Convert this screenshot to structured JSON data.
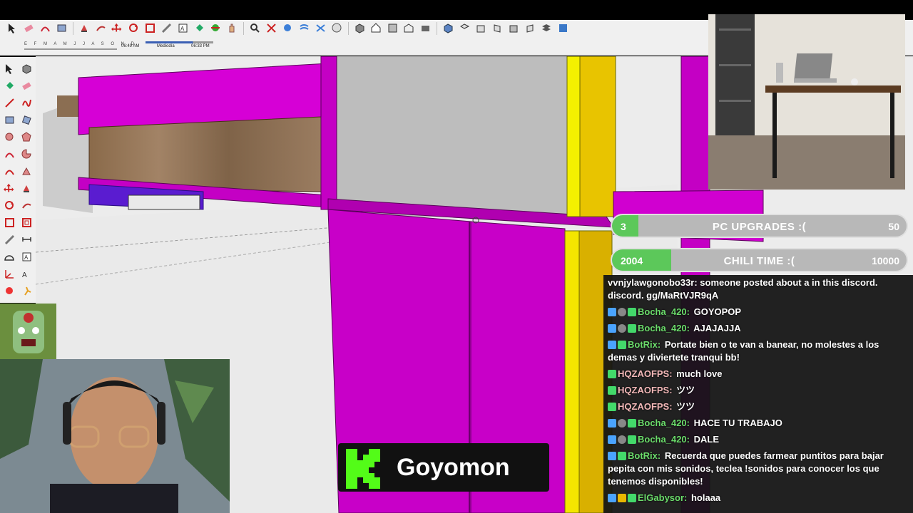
{
  "shadow": {
    "months": "E F M A M J J A S O N D",
    "time_start": "06:49 AM",
    "time_mid": "Mediodía",
    "time_end": "06:33 PM"
  },
  "goals": [
    {
      "count": "3",
      "label": "PC UPGRADES :(",
      "target": "50",
      "progress": 0.06,
      "color": "#5cc85a"
    },
    {
      "count": "2004",
      "label": "CHILI TIME :(",
      "target": "10000",
      "progress": 0.2,
      "color": "#5cc85a"
    }
  ],
  "chat": {
    "messages": [
      {
        "user": "",
        "user_color": "#ffffff",
        "text": "vvnjylawgonobo33r: someone posted about a in this discord. discord. gg/MaRtVJR9qA",
        "badges": []
      },
      {
        "user": "Bocha_420",
        "user_color": "#6bdc6b",
        "text": "GOYOPOP",
        "badges": [
          "blue",
          "gray",
          "green"
        ]
      },
      {
        "user": "Bocha_420",
        "user_color": "#6bdc6b",
        "text": "AJAJAJJA",
        "badges": [
          "blue",
          "gray",
          "green"
        ]
      },
      {
        "user": "BotRix",
        "user_color": "#6bdc6b",
        "text": "Portate bien o te van a banear, no molestes a los demas y diviertete tranqui bb!",
        "badges": [
          "blue",
          "green"
        ]
      },
      {
        "user": "HQZAOFPS",
        "user_color": "#f1b7b7",
        "text": "much love",
        "badges": [
          "green"
        ]
      },
      {
        "user": "HQZAOFPS",
        "user_color": "#f1b7b7",
        "text": "ツツ",
        "badges": [
          "green"
        ]
      },
      {
        "user": "HQZAOFPS",
        "user_color": "#f1b7b7",
        "text": "ツツ",
        "badges": [
          "green"
        ]
      },
      {
        "user": "Bocha_420",
        "user_color": "#6bdc6b",
        "text": "HACE TU TRABAJO",
        "badges": [
          "blue",
          "gray",
          "green"
        ]
      },
      {
        "user": "Bocha_420",
        "user_color": "#6bdc6b",
        "text": "DALE",
        "badges": [
          "blue",
          "gray",
          "green"
        ]
      },
      {
        "user": "BotRix",
        "user_color": "#6bdc6b",
        "text": "Recuerda que puedes farmear puntitos para bajar pepita con mis sonidos, teclea !sonidos para conocer los que tenemos disponibles!",
        "badges": [
          "blue",
          "green"
        ]
      },
      {
        "user": "ElGabysor",
        "user_color": "#6bdc6b",
        "text": "holaaa",
        "badges": [
          "blue",
          "gold",
          "green"
        ]
      }
    ]
  },
  "streamer": {
    "name": "Goyomon"
  },
  "icons": {
    "toolbar": [
      "select-icon",
      "eraser-icon",
      "arc-icon",
      "rectangle-icon",
      "push-pull-icon",
      "follow-me-icon",
      "move-icon",
      "rotate-icon",
      "scale-icon",
      "tape-measure-icon",
      "text-icon",
      "paint-bucket-icon",
      "orbit-icon",
      "pan-icon",
      "zoom-icon",
      "zoom-extents-icon",
      "previous-view-icon",
      "section-plane-icon",
      "xray-icon",
      "styles-icon",
      "components-icon",
      "house-icon",
      "materials-icon",
      "warehouse-icon",
      "extension-icon",
      "iso-view-icon",
      "top-view-icon",
      "front-view-icon",
      "right-view-icon",
      "back-view-icon",
      "left-view-icon",
      "layers-icon",
      "scenes-icon"
    ],
    "left": [
      "select-icon",
      "components-icon",
      "paint-bucket-icon",
      "eraser-icon",
      "line-icon",
      "freehand-icon",
      "rectangle-icon",
      "rotated-rectangle-icon",
      "circle-icon",
      "polygon-icon",
      "arc-icon",
      "pie-icon",
      "arc3-icon",
      "pie3-icon",
      "move-icon",
      "push-pull-icon",
      "rotate-icon",
      "follow-me-icon",
      "scale-icon",
      "offset-icon",
      "tape-measure-icon",
      "dimension-icon",
      "protractor-icon",
      "text-icon",
      "axes-icon",
      "3d-text-icon",
      "section-icon",
      "walk-icon"
    ]
  }
}
